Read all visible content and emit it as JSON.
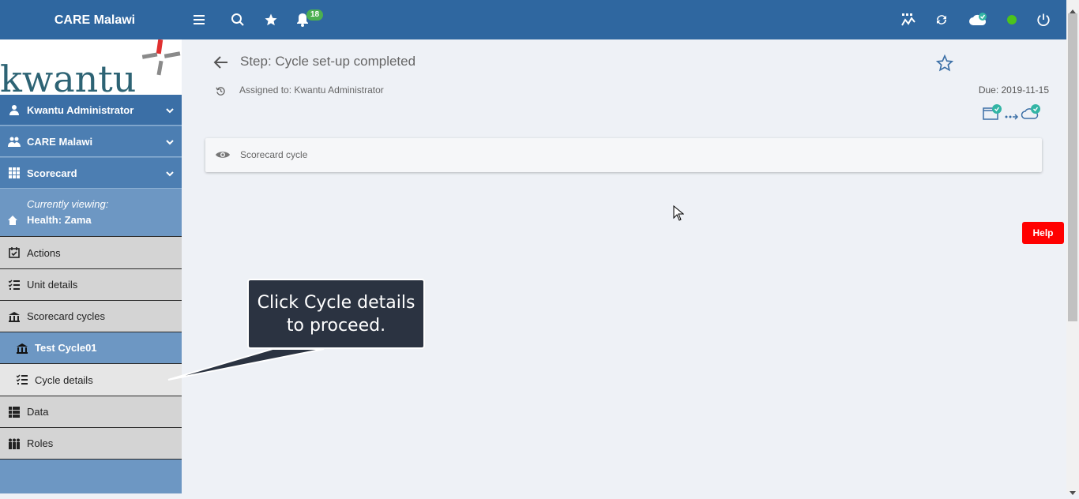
{
  "topbar": {
    "brand": "CARE Malawi",
    "notification_count": "18"
  },
  "sidebar": {
    "logo_text": "kwantu",
    "items": [
      {
        "label": "Kwantu Administrator"
      },
      {
        "label": "CARE Malawi"
      },
      {
        "label": "Scorecard"
      },
      {
        "label": "Actions"
      },
      {
        "label": "Unit details"
      },
      {
        "label": "Scorecard cycles"
      },
      {
        "label": "Test Cycle01"
      },
      {
        "label": "Cycle details"
      },
      {
        "label": "Data"
      },
      {
        "label": "Roles"
      }
    ],
    "viewing": {
      "caption": "Currently viewing:",
      "value": "Health: Zama"
    }
  },
  "main": {
    "title": "Step: Cycle set-up completed",
    "assigned": "Assigned to: Kwantu Administrator",
    "due": "Due: 2019-11-15",
    "card_label": "Scorecard cycle"
  },
  "help_label": "Help",
  "callout": {
    "line1": "Click Cycle details",
    "line2": "to proceed."
  },
  "colors": {
    "topbar": "#2f67a0",
    "sidebar": "#6d97c3",
    "help": "#ff0000",
    "badge": "#4caf50"
  }
}
